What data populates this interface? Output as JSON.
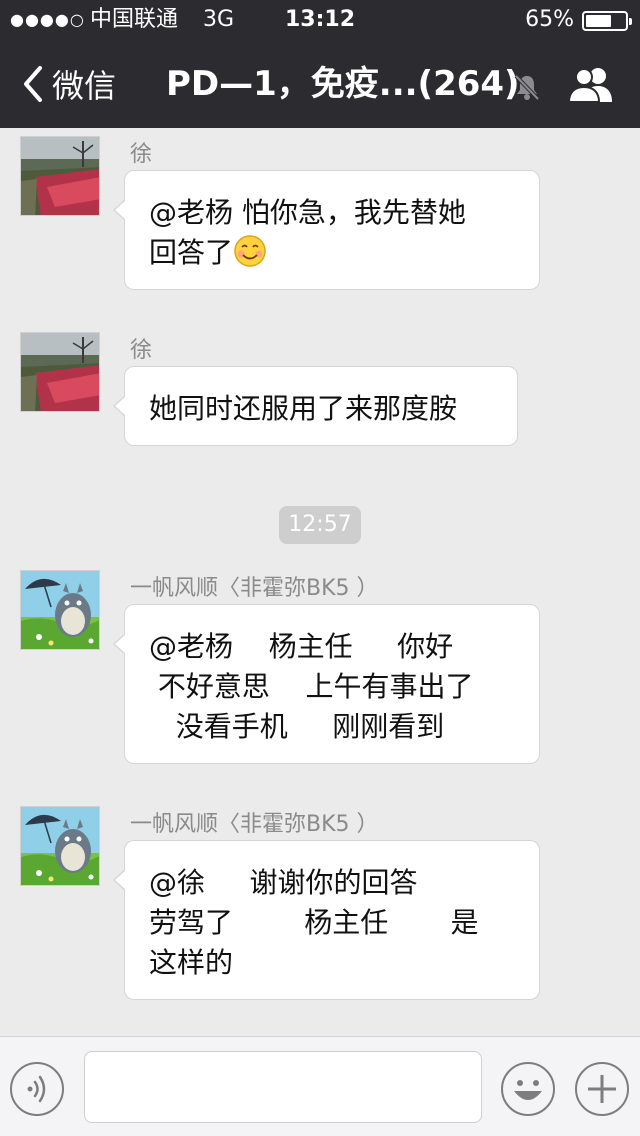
{
  "status_bar": {
    "signal": "●●●●○",
    "carrier": "中国联通",
    "network": "3G",
    "time": "13:12",
    "battery_percent": "65%",
    "battery_level": 0.65
  },
  "nav": {
    "back_label": "微信",
    "title": "PD—1，免疫...(264)",
    "mute_icon": "bell-muted-icon",
    "members_icon": "group-members-icon"
  },
  "messages": [
    {
      "sender": "徐",
      "text": "@老杨 怕你急，我先替她\n回答了",
      "emoji": "smiley-face-emoji",
      "avatar": "flower-garden-photo"
    },
    {
      "sender": "徐",
      "text": "她同时还服用了来那度胺",
      "avatar": "flower-garden-photo"
    },
    {
      "sender": "一帆风顺〈非霍弥BK5 ）",
      "text": "@老杨    杨主任     你好\n 不好意思    上午有事出了\n   没看手机     刚刚看到",
      "avatar": "totoro-umbrella-cartoon"
    },
    {
      "sender": "一帆风顺〈非霍弥BK5 ）",
      "text": "@徐     谢谢你的回答\n劳驾了        杨主任       是\n这样的",
      "avatar": "totoro-umbrella-cartoon"
    }
  ],
  "timestamp": "12:57",
  "input_bar": {
    "voice_icon": "voice-input-icon",
    "text_value": "",
    "emoji_icon": "emoji-icon",
    "plus_icon": "plus-icon"
  },
  "colors": {
    "nav_bg": "#2c2c30",
    "chat_bg": "#ebebeb",
    "bubble_bg": "#ffffff",
    "timestamp_bg": "#cecece"
  }
}
